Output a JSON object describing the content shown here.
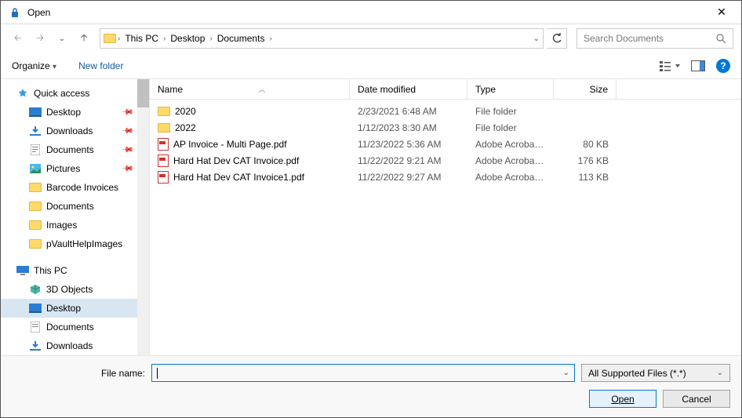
{
  "window": {
    "title": "Open"
  },
  "breadcrumb": {
    "items": [
      "This PC",
      "Desktop",
      "Documents"
    ]
  },
  "search": {
    "placeholder": "Search Documents"
  },
  "toolbar": {
    "organize": "Organize",
    "newfolder": "New folder"
  },
  "nav": {
    "quick": "Quick access",
    "desktop": "Desktop",
    "downloads": "Downloads",
    "documents": "Documents",
    "pictures": "Pictures",
    "barcode": "Barcode Invoices",
    "documents2": "Documents",
    "images": "Images",
    "pvault": "pVaultHelpImages",
    "thispc": "This PC",
    "objects3d": "3D Objects",
    "desktop2": "Desktop",
    "documents3": "Documents",
    "downloads2": "Downloads"
  },
  "columns": {
    "name": "Name",
    "date": "Date modified",
    "type": "Type",
    "size": "Size"
  },
  "files": [
    {
      "icon": "folder",
      "name": "2020",
      "date": "2/23/2021 6:48 AM",
      "type": "File folder",
      "size": ""
    },
    {
      "icon": "folder",
      "name": "2022",
      "date": "1/12/2023 8:30 AM",
      "type": "File folder",
      "size": ""
    },
    {
      "icon": "pdf",
      "name": "AP Invoice - Multi Page.pdf",
      "date": "11/23/2022 5:36 AM",
      "type": "Adobe Acrobat D...",
      "size": "80 KB"
    },
    {
      "icon": "pdf",
      "name": "Hard Hat Dev CAT Invoice.pdf",
      "date": "11/22/2022 9:21 AM",
      "type": "Adobe Acrobat D...",
      "size": "176 KB"
    },
    {
      "icon": "pdf",
      "name": "Hard Hat Dev CAT Invoice1.pdf",
      "date": "11/22/2022 9:27 AM",
      "type": "Adobe Acrobat D...",
      "size": "113 KB"
    }
  ],
  "footer": {
    "filename_label": "File name:",
    "filter": "All Supported Files (*.*)",
    "open": "Open",
    "cancel": "Cancel"
  }
}
